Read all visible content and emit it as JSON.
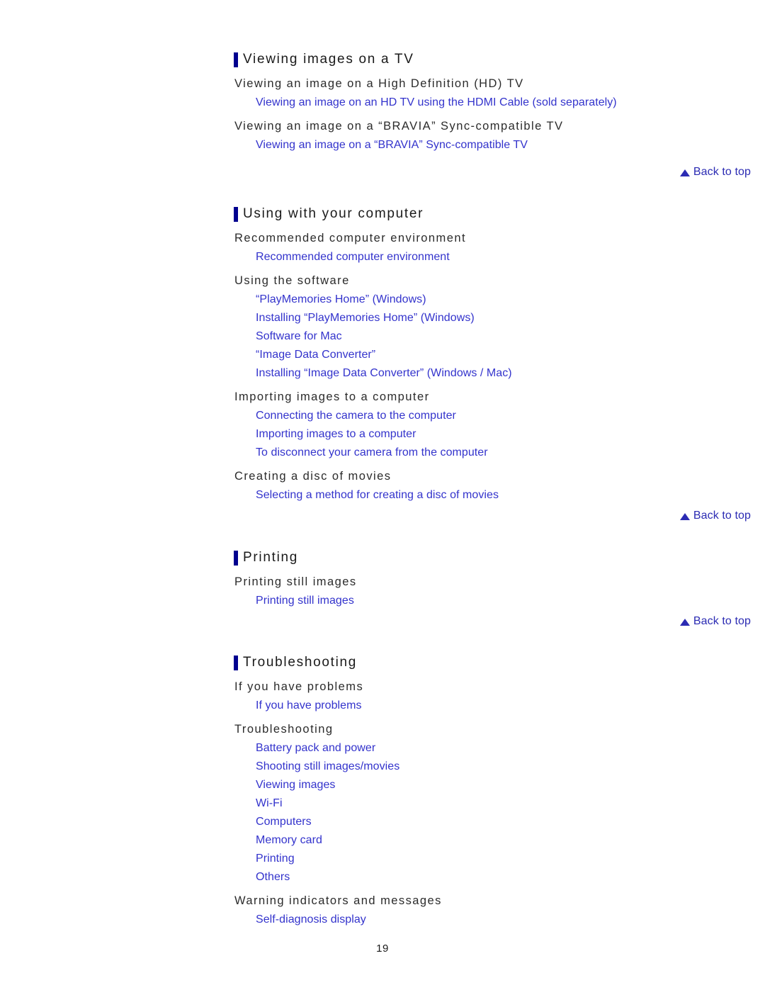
{
  "page": {
    "number": "19",
    "background": "#ffffff",
    "link_color": "#3333cc",
    "marker_color": "#00008f",
    "heading_color": "#1a1a1a",
    "back_to_top_color": "#2b2bb3"
  },
  "back_to_top": {
    "label": "Back to top",
    "icon": "triangle-up-icon"
  },
  "sections": [
    {
      "title": "Viewing images on a TV",
      "groups": [
        {
          "subheading": "Viewing an image on a High Definition (HD) TV",
          "links": [
            "Viewing an image on an HD TV using the HDMI Cable (sold separately)"
          ]
        },
        {
          "subheading": "Viewing an image on a “BRAVIA” Sync-compatible TV",
          "links": [
            "Viewing an image on a “BRAVIA” Sync-compatible TV"
          ]
        }
      ]
    },
    {
      "title": "Using with your computer",
      "groups": [
        {
          "subheading": "Recommended computer environment",
          "links": [
            "Recommended computer environment"
          ]
        },
        {
          "subheading": "Using the software",
          "links": [
            "“PlayMemories Home” (Windows)",
            "Installing “PlayMemories Home” (Windows)",
            "Software for Mac",
            "“Image Data Converter”",
            "Installing “Image Data Converter” (Windows / Mac)"
          ]
        },
        {
          "subheading": "Importing images to a computer",
          "links": [
            "Connecting the camera to the computer",
            "Importing images to a computer",
            "To disconnect your camera from the computer"
          ]
        },
        {
          "subheading": "Creating a disc of movies",
          "links": [
            "Selecting a method for creating a disc of movies"
          ]
        }
      ]
    },
    {
      "title": "Printing",
      "groups": [
        {
          "subheading": "Printing still images",
          "links": [
            "Printing still images"
          ]
        }
      ]
    },
    {
      "title": "Troubleshooting",
      "groups": [
        {
          "subheading": "If you have problems",
          "links": [
            "If you have problems"
          ]
        },
        {
          "subheading": "Troubleshooting",
          "links": [
            "Battery pack and power",
            "Shooting still images/movies",
            "Viewing images",
            "Wi-Fi",
            "Computers",
            "Memory card",
            "Printing",
            "Others"
          ]
        },
        {
          "subheading": "Warning indicators and messages",
          "links": [
            "Self-diagnosis display"
          ]
        }
      ]
    }
  ]
}
